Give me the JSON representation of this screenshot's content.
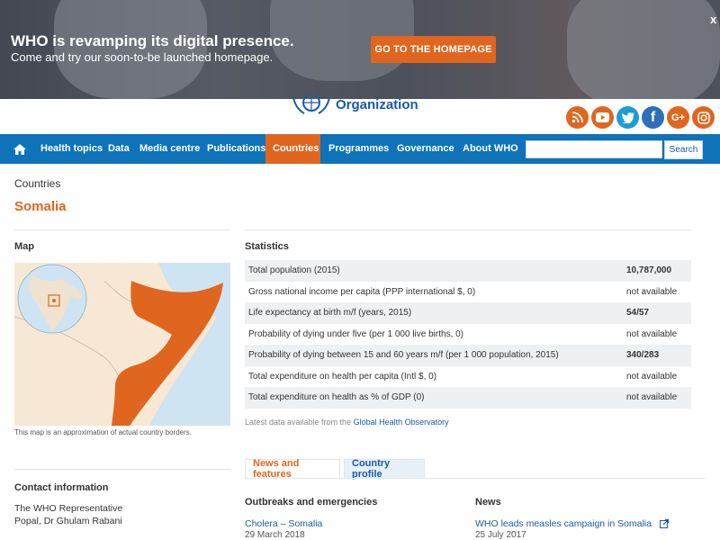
{
  "banner": {
    "title": "WHO is revamping its digital presence.",
    "subtitle": "Come and try our soon-to-be launched homepage.",
    "button": "GO TO THE HOMEPAGE",
    "close": "x"
  },
  "header": {
    "logo_text": "Organization",
    "social": [
      {
        "name": "rss-icon",
        "color": "#e0661f"
      },
      {
        "name": "youtube-icon",
        "color": "#e0661f"
      },
      {
        "name": "twitter-icon",
        "color": "#1d9bd7"
      },
      {
        "name": "facebook-icon",
        "color": "#2d6fb8"
      },
      {
        "name": "googleplus-icon",
        "color": "#e0661f",
        "label": "G+"
      },
      {
        "name": "instagram-icon",
        "color": "#e0661f"
      }
    ]
  },
  "nav": {
    "items": [
      {
        "label": "Health topics"
      },
      {
        "label": "Data"
      },
      {
        "label": "Media centre"
      },
      {
        "label": "Publications"
      },
      {
        "label": "Countries",
        "active": true
      },
      {
        "label": "Programmes"
      },
      {
        "label": "Governance"
      },
      {
        "label": "About WHO"
      }
    ],
    "search_button": "Search"
  },
  "breadcrumb": "Countries",
  "page_title": "Somalia",
  "map": {
    "heading": "Map",
    "caption": "This map is an approximation of actual country borders."
  },
  "statistics": {
    "heading": "Statistics",
    "rows": [
      {
        "label": "Total population (2015)",
        "value": "10,787,000",
        "bold": true
      },
      {
        "label": "Gross national income per capita (PPP international $, 0)",
        "value": "not available",
        "bold": false
      },
      {
        "label": "Life expectancy at birth m/f (years, 2015)",
        "value": "54/57",
        "bold": true
      },
      {
        "label": "Probability of dying under five (per 1 000 live births, 0)",
        "value": "not available",
        "bold": false
      },
      {
        "label": "Probability of dying between 15 and 60 years m/f (per 1 000 population, 2015)",
        "value": "340/283",
        "bold": true
      },
      {
        "label": "Total expenditure on health per capita (Intl $, 0)",
        "value": "not available",
        "bold": false
      },
      {
        "label": "Total expenditure on health as % of GDP (0)",
        "value": "not available",
        "bold": false
      }
    ],
    "note_prefix": "Latest data available from the ",
    "note_link": "Global Health Observatory"
  },
  "tabs": [
    {
      "label": "News and features",
      "active": true
    },
    {
      "label": "Country profile",
      "active": false
    }
  ],
  "contact": {
    "heading": "Contact information",
    "lines": [
      "The WHO Representative",
      "Popal, Dr Ghulam Rabani"
    ]
  },
  "outbreaks": {
    "heading": "Outbreaks and emergencies",
    "item_title": "Cholera – Somalia",
    "item_date": "29 March 2018"
  },
  "news": {
    "heading": "News",
    "item_title": "WHO leads measles campaign in Somalia",
    "item_date": "25 July 2017"
  }
}
